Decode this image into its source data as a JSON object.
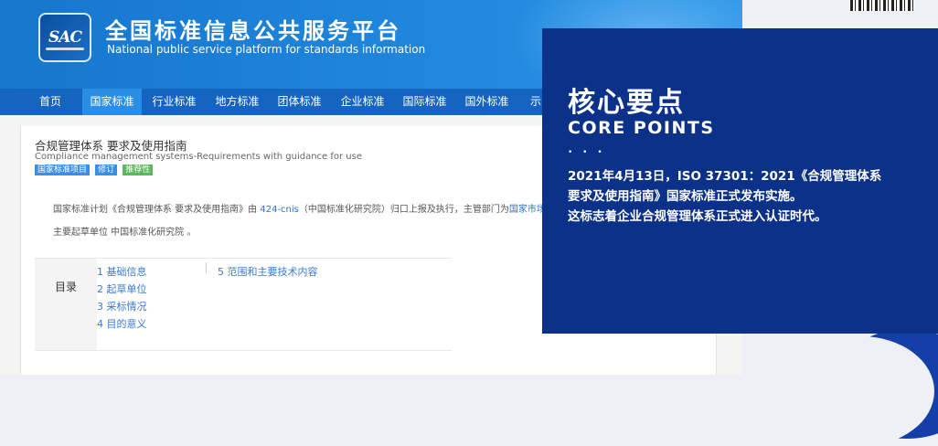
{
  "site": {
    "logo_text": "SAC",
    "title_cn": "全国标准信息公共服务平台",
    "title_en": "National public service platform  for standards information"
  },
  "nav": {
    "items": [
      {
        "label": "首页"
      },
      {
        "label": "国家标准"
      },
      {
        "label": "行业标准"
      },
      {
        "label": "地方标准"
      },
      {
        "label": "团体标准"
      },
      {
        "label": "企业标准"
      },
      {
        "label": "国际标准"
      },
      {
        "label": "国外标准"
      },
      {
        "label": "示"
      }
    ],
    "active_index": 1
  },
  "doc": {
    "title": "合规管理体系 要求及使用指南",
    "subtitle": "Compliance management systems-Requirements with guidance for use",
    "tags": [
      "国家标准项目",
      "修订",
      "推荐性"
    ],
    "desc_prefix": "国家标准计划《合规管理体系 要求及使用指南》由 ",
    "desc_link": "424-cnis",
    "desc_middle": "（中国标准化研究院）归口上报及执行，主管部门为",
    "desc_link2": "国家市场监督管理总",
    "drafter": "主要起草单位 中国标准化研究院 。"
  },
  "toc": {
    "label": "目录",
    "items": [
      "1  基础信息",
      "2  起草单位",
      "3  采标情况",
      "4  目的意义",
      "5  范围和主要技术内容"
    ]
  },
  "panel": {
    "title": "核心要点",
    "title_en": "CORE POINTS",
    "dots": "• • •",
    "body": [
      "2021年4月13日，ISO 37301：2021《合规管理体系",
      "要求及使用指南》国家标准正式发布实施。",
      "这标志着企业合规管理体系正式进入认证时代。"
    ]
  },
  "colors": {
    "header_blue": "#1f86dc",
    "nav_blue": "#1565c0",
    "nav_active": "#2b8ee5",
    "panel_navy": "#0c3189",
    "link": "#2a72c9",
    "tag_blue": "#3a8ee6",
    "tag_green": "#5cb85c"
  }
}
